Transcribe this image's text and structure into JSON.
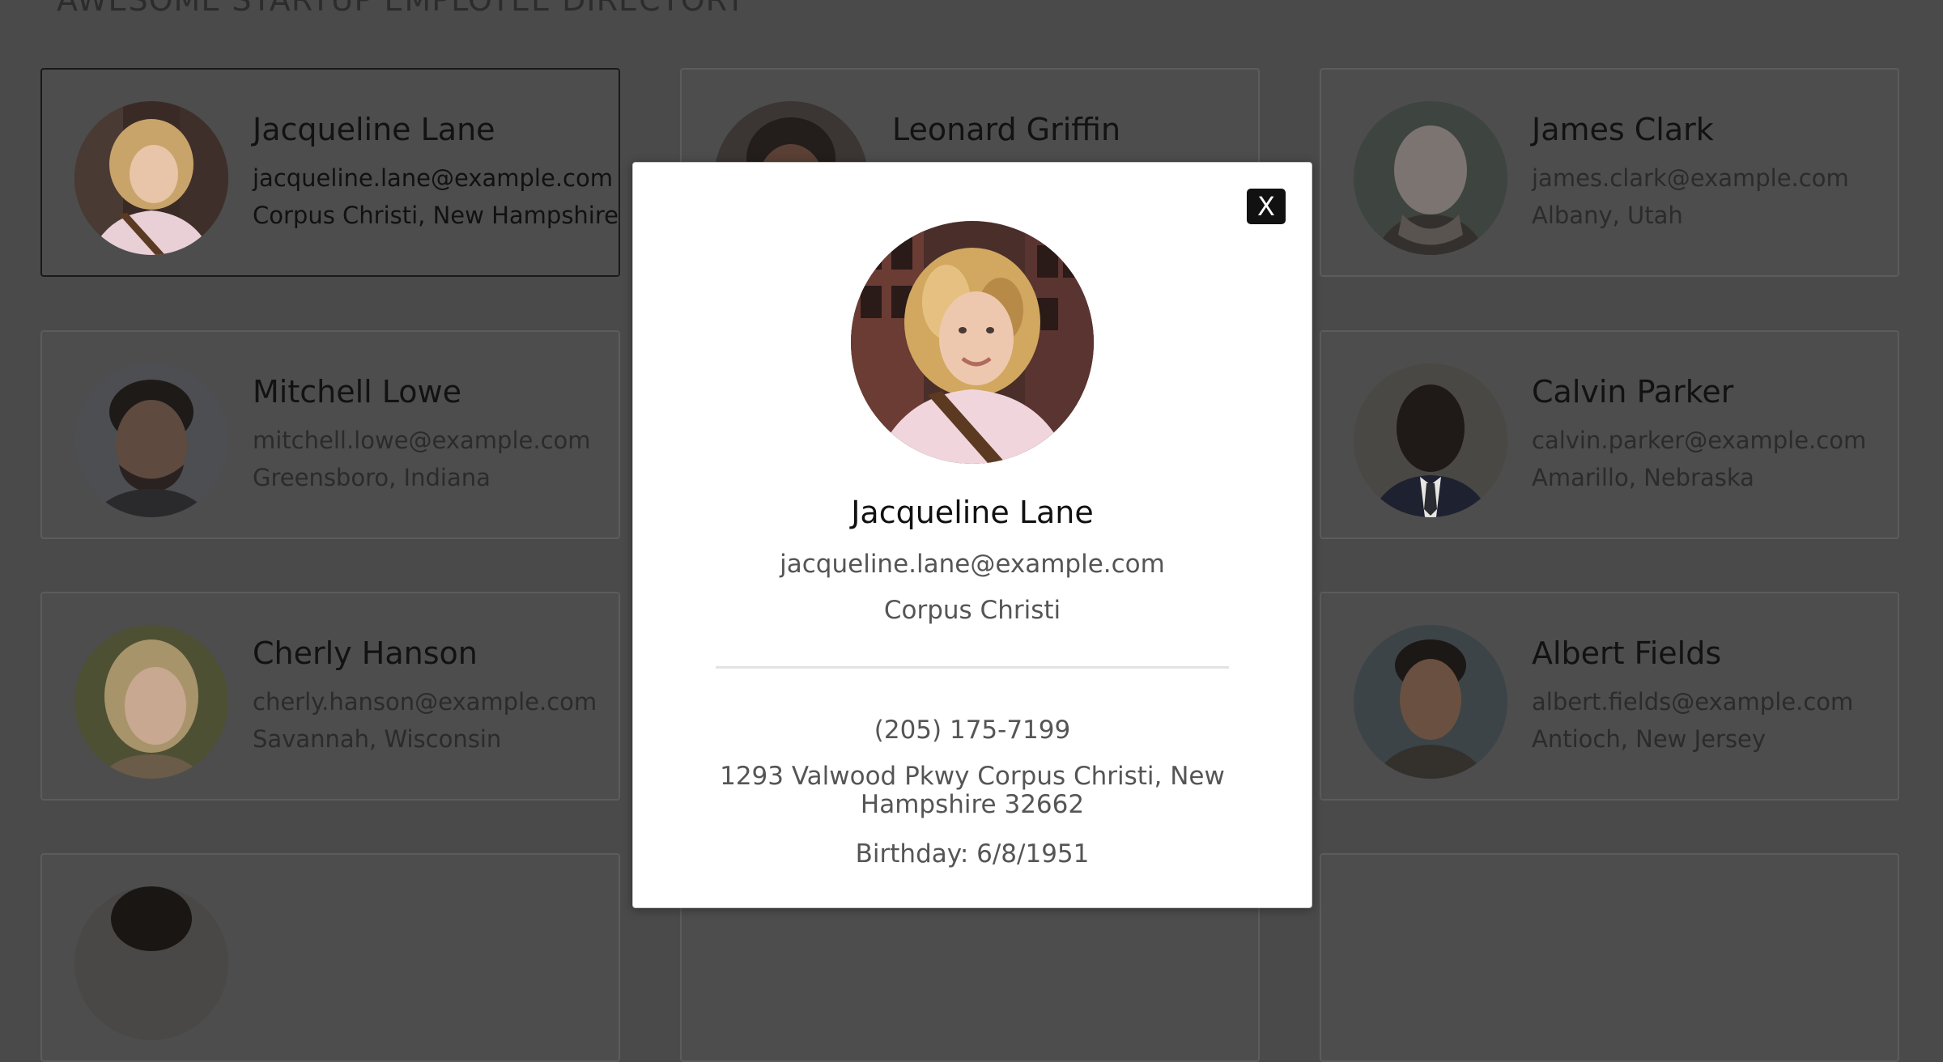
{
  "page": {
    "title": "AWESOME STARTUP EMPLOYEE DIRECTORY"
  },
  "employees": [
    {
      "name": "Jacqueline Lane",
      "email": "jacqueline.lane@example.com",
      "location": "Corpus Christi, New Hampshire",
      "selected": true
    },
    {
      "name": "Leonard Griffin",
      "email": "",
      "location": ""
    },
    {
      "name": "James Clark",
      "email": "james.clark@example.com",
      "location": "Albany, Utah"
    },
    {
      "name": "Mitchell Lowe",
      "email": "mitchell.lowe@example.com",
      "location": "Greensboro, Indiana"
    },
    {
      "name": "",
      "email": "",
      "location": ""
    },
    {
      "name": "Calvin Parker",
      "email": "calvin.parker@example.com",
      "location": "Amarillo, Nebraska"
    },
    {
      "name": "Cherly Hanson",
      "email": "cherly.hanson@example.com",
      "location": "Savannah, Wisconsin"
    },
    {
      "name": "",
      "email": "",
      "location": ""
    },
    {
      "name": "Albert Fields",
      "email": "albert.fields@example.com",
      "location": "Antioch, New Jersey"
    },
    {
      "name": "",
      "email": "",
      "location": ""
    },
    {
      "name": "",
      "email": "",
      "location": ""
    },
    {
      "name": "",
      "email": "",
      "location": ""
    }
  ],
  "modal": {
    "close_label": "X",
    "name": "Jacqueline Lane",
    "email": "jacqueline.lane@example.com",
    "city": "Corpus Christi",
    "phone": "(205) 175-7199",
    "address": "1293 Valwood Pkwy Corpus Christi, New Hampshire 32662",
    "birthday": "Birthday: 6/8/1951"
  },
  "colors": {
    "overlay_background": "#4a4a4a",
    "modal_background": "#ffffff",
    "close_button": "#111111",
    "avatar_jacqueline": "#c9a46a",
    "avatar_leonard": "#2a2522",
    "avatar_james": "#7c7a78",
    "avatar_mitchell": "#4a4540",
    "avatar_calvin": "#2c2a28",
    "avatar_cherly": "#a8946a",
    "avatar_albert": "#34302c"
  }
}
